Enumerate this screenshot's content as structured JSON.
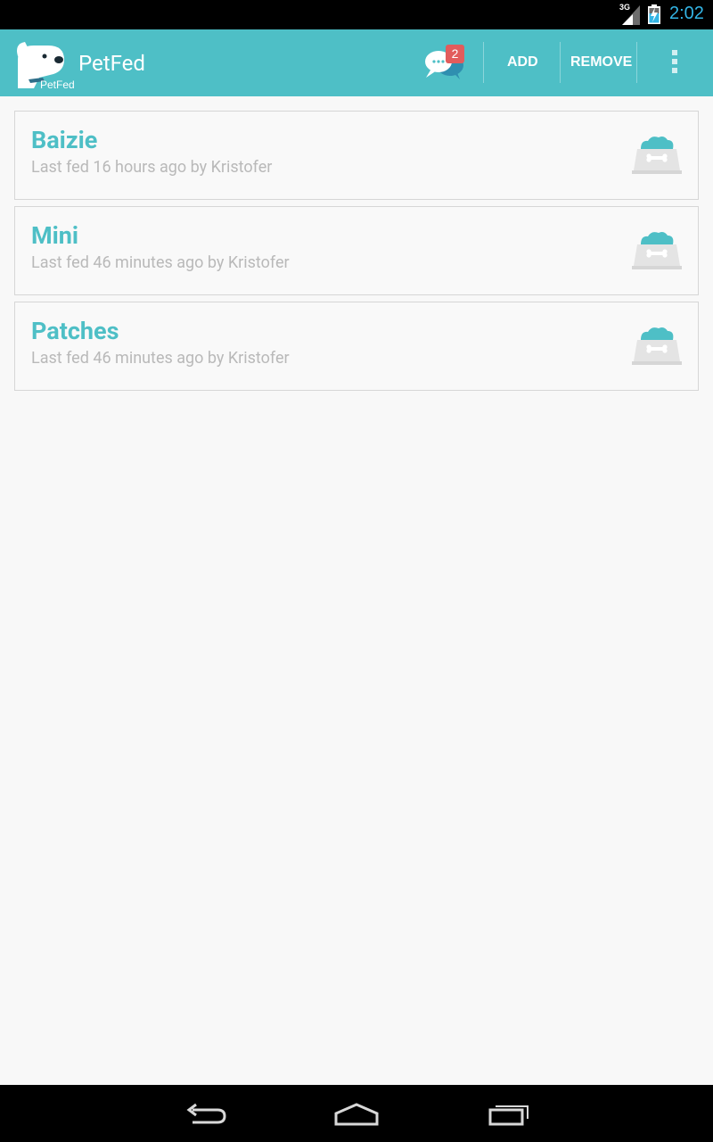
{
  "status_bar": {
    "network": "3G",
    "time": "2:02",
    "time_color": "#33b5e5"
  },
  "action_bar": {
    "title": "PetFed",
    "logo_text": "PetFed",
    "notification_count": "2",
    "add_label": "ADD",
    "remove_label": "REMOVE",
    "background": "#4ebfc6",
    "icons": [
      "petfed-logo-icon",
      "chat-bubbles-icon",
      "overflow-menu-icon"
    ]
  },
  "pets": [
    {
      "name": "Baizie",
      "last_fed": "Last fed 16 hours ago by Kristofer"
    },
    {
      "name": "Mini",
      "last_fed": "Last fed 46 minutes ago by Kristofer"
    },
    {
      "name": "Patches",
      "last_fed": "Last fed 46 minutes ago by Kristofer"
    }
  ],
  "colors": {
    "accent": "#4ebfc6",
    "badge": "#e25c5c",
    "secondary_text": "#b9b9b9"
  },
  "nav_bar": {
    "icons": [
      "back-icon",
      "home-icon",
      "recent-apps-icon"
    ]
  }
}
